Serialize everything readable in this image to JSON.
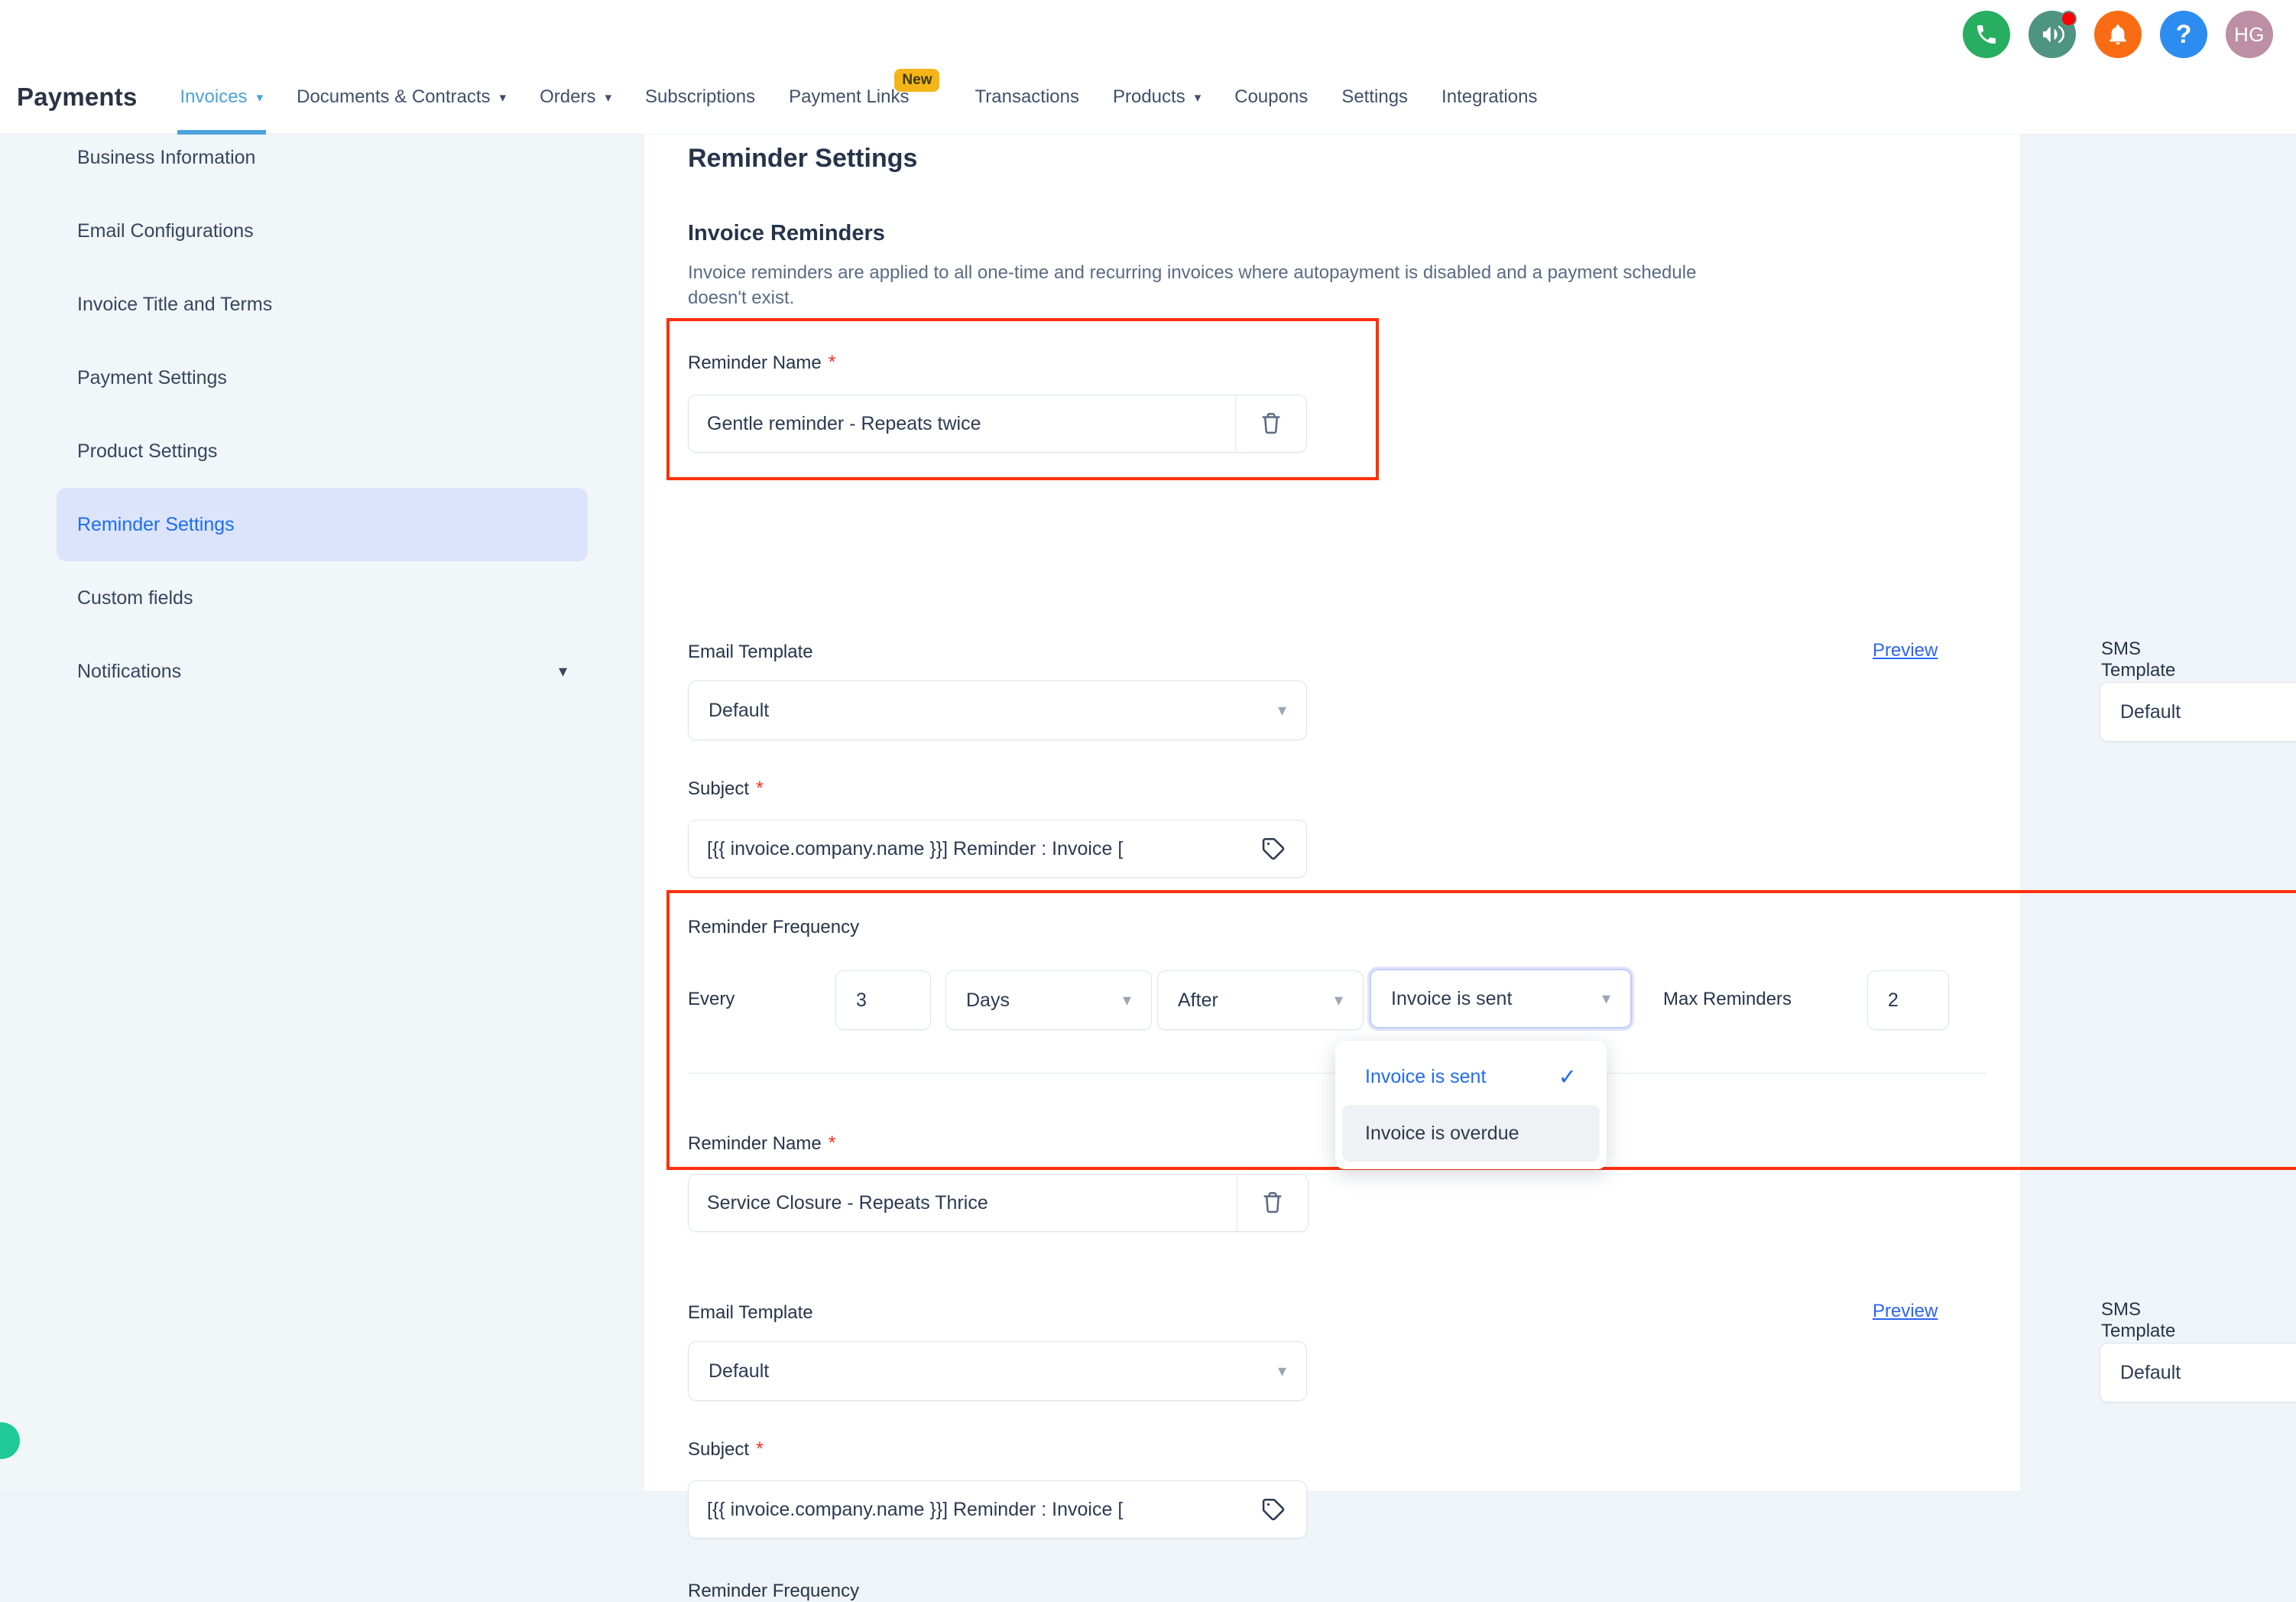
{
  "topbar": {
    "icons": [
      {
        "name": "phone-icon",
        "color": "#27ae60"
      },
      {
        "name": "megaphone-icon",
        "color": "#4f9480",
        "badge": true
      },
      {
        "name": "bell-icon",
        "color": "#f96c13"
      },
      {
        "name": "help-icon",
        "color": "#2d8cf0",
        "glyph": "?"
      },
      {
        "name": "avatar",
        "color": "#bd8fa4",
        "initials": "HG"
      }
    ]
  },
  "nav": {
    "brand": "Payments",
    "items": [
      {
        "label": "Invoices",
        "caret": true,
        "active": true
      },
      {
        "label": "Documents & Contracts",
        "caret": true,
        "active": false
      },
      {
        "label": "Orders",
        "caret": true,
        "active": false
      },
      {
        "label": "Subscriptions",
        "caret": false,
        "active": false
      },
      {
        "label": "Payment Links",
        "caret": false,
        "active": false,
        "badge": "New"
      },
      {
        "label": "Transactions",
        "caret": false,
        "active": false
      },
      {
        "label": "Products",
        "caret": true,
        "active": false
      },
      {
        "label": "Coupons",
        "caret": false,
        "active": false
      },
      {
        "label": "Settings",
        "caret": false,
        "active": false
      },
      {
        "label": "Integrations",
        "caret": false,
        "active": false
      }
    ]
  },
  "sidebar": {
    "items": [
      {
        "label": "Business Information",
        "active": false,
        "chevron": false
      },
      {
        "label": "Email Configurations",
        "active": false,
        "chevron": false
      },
      {
        "label": "Invoice Title and Terms",
        "active": false,
        "chevron": false
      },
      {
        "label": "Payment Settings",
        "active": false,
        "chevron": false
      },
      {
        "label": "Product Settings",
        "active": false,
        "chevron": false
      },
      {
        "label": "Reminder Settings",
        "active": true,
        "chevron": false
      },
      {
        "label": "Custom fields",
        "active": false,
        "chevron": false
      },
      {
        "label": "Notifications",
        "active": false,
        "chevron": true
      }
    ]
  },
  "page": {
    "title": "Reminder Settings",
    "section_title": "Invoice Reminders",
    "section_desc": "Invoice reminders are applied to all one-time and recurring invoices where autopayment is disabled and a payment schedule doesn't exist."
  },
  "labels": {
    "reminder_name": "Reminder Name",
    "email_template": "Email Template",
    "sms_template": "SMS Template",
    "preview": "Preview",
    "subject": "Subject",
    "reminder_frequency": "Reminder Frequency",
    "every": "Every",
    "max_reminders": "Max Reminders",
    "required_mark": "*"
  },
  "reminder_1": {
    "name": "Gentle reminder - Repeats twice",
    "email_template": "Default",
    "sms_template": "Default",
    "subject": "[{{ invoice.company.name }}] Reminder : Invoice [",
    "enabled": false,
    "frequency": {
      "interval": "3",
      "unit": "Days",
      "relation": "After",
      "event": "Invoice is sent",
      "max_reminders": "2"
    }
  },
  "reminder_2": {
    "name": "Service Closure - Repeats Thrice",
    "email_template": "Default",
    "sms_template": "Default",
    "subject": "[{{ invoice.company.name }}] Reminder : Invoice [",
    "enabled": true
  },
  "event_dropdown": {
    "open": true,
    "options": [
      {
        "label": "Invoice is sent",
        "selected": true
      },
      {
        "label": "Invoice is overdue",
        "selected": false
      }
    ]
  }
}
